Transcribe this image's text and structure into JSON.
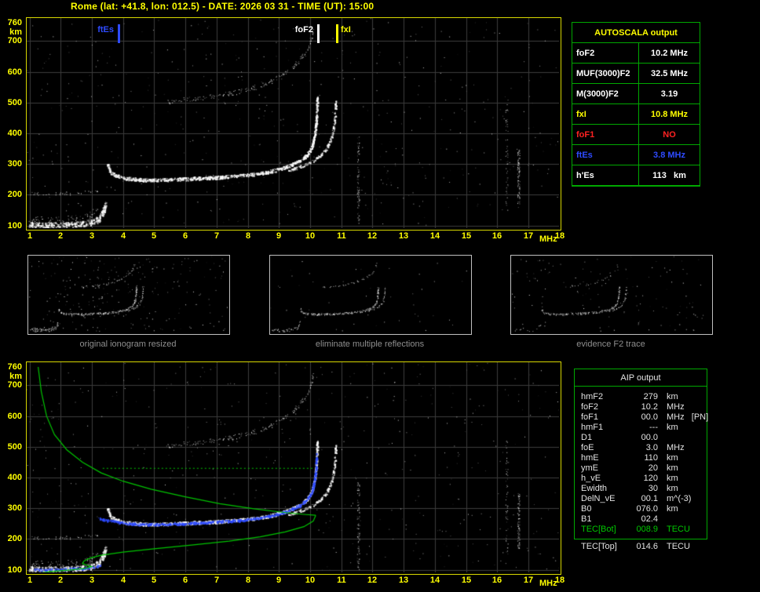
{
  "title": "Rome (lat: +41.8, lon: 012.5) - DATE: 2026 03 31 - TIME (UT): 15:00",
  "colors": {
    "accent_yellow": "#ffff00",
    "grid": "#3c3c3c",
    "border_green": "#00a800",
    "trace_white": "#ffffff",
    "fit_blue": "#2e4bff",
    "profile_green": "#00c400",
    "alert_red": "#ff2222",
    "caption_gray": "#8f8f8f"
  },
  "autoscala": {
    "header": "AUTOSCALA output",
    "rows": [
      {
        "label": "foF2",
        "value": "10.2 MHz",
        "color": "#ffffff"
      },
      {
        "label": "MUF(3000)F2",
        "value": "32.5 MHz",
        "color": "#ffffff"
      },
      {
        "label": "M(3000)F2",
        "value": "3.19",
        "color": "#ffffff"
      },
      {
        "label": "fxI",
        "value": "10.8 MHz",
        "color": "#ffff00"
      },
      {
        "label": "foF1",
        "value": "NO",
        "color": "#ff2222"
      },
      {
        "label": "ftEs",
        "value": "3.8 MHz",
        "color": "#2e4bff"
      },
      {
        "label": "h'Es",
        "value": "113   km",
        "color": "#ffffff"
      }
    ]
  },
  "aip": {
    "header": "AIP output",
    "rows": [
      {
        "label": "hmF2",
        "value": "279",
        "unit": "km"
      },
      {
        "label": "foF2",
        "value": "10.2",
        "unit": "MHz"
      },
      {
        "label": "foF1",
        "value": "00.0",
        "unit": "MHz   [PN]"
      },
      {
        "label": "hmF1",
        "value": "---",
        "unit": "km"
      },
      {
        "label": "D1",
        "value": "00.0",
        "unit": ""
      },
      {
        "label": "foE",
        "value": "3.0",
        "unit": "MHz"
      },
      {
        "label": "hmE",
        "value": "110",
        "unit": "km"
      },
      {
        "label": "ymE",
        "value": "20",
        "unit": "km"
      },
      {
        "label": "h_vE",
        "value": "120",
        "unit": "km"
      },
      {
        "label": "Ewidth",
        "value": "30",
        "unit": "km"
      },
      {
        "label": "DelN_vE",
        "value": "00.1",
        "unit": "m^(-3)"
      },
      {
        "label": "B0",
        "value": "076.0",
        "unit": "km"
      },
      {
        "label": "B1",
        "value": "02.4",
        "unit": ""
      },
      {
        "label": "TEC[Bot]",
        "value": "008.9",
        "unit": "TECU",
        "color": "green"
      }
    ],
    "footer_row": {
      "label": "TEC[Top]",
      "value": "014.6",
      "unit": "TECU"
    }
  },
  "thumbnails": [
    {
      "caption": "original ionogram resized"
    },
    {
      "caption": "eliminate multiple reflections"
    },
    {
      "caption": "evidence F2 trace"
    }
  ],
  "axes": {
    "x_ticks": [
      1,
      2,
      3,
      4,
      5,
      6,
      7,
      8,
      9,
      10,
      11,
      12,
      13,
      14,
      15,
      16,
      17,
      18
    ],
    "x_unit": "MHz",
    "y_ticks": [
      760,
      700,
      600,
      500,
      400,
      300,
      200,
      100
    ],
    "y_unit": "km"
  },
  "markers": [
    {
      "label": "ftEs",
      "freq": 3.8,
      "color": "#2e4bff",
      "side": "left"
    },
    {
      "label": "foF2",
      "freq": 10.2,
      "color": "#ffffff",
      "side": "left"
    },
    {
      "label": "fxI",
      "freq": 10.8,
      "color": "#ffff00",
      "side": "right"
    }
  ],
  "chart_data": {
    "type": "scatter",
    "x_range": [
      1,
      18
    ],
    "y_range": [
      100,
      760
    ],
    "xlabel": "MHz",
    "ylabel": "km",
    "grid": true,
    "traces": {
      "E": [
        [
          1.0,
          104
        ],
        [
          1.5,
          101
        ],
        [
          2.1,
          102
        ],
        [
          2.6,
          105
        ],
        [
          2.95,
          110
        ],
        [
          3.15,
          118
        ],
        [
          3.3,
          132
        ],
        [
          3.38,
          152
        ],
        [
          3.42,
          172
        ]
      ],
      "Es_spread": [
        [
          1.05,
          118
        ],
        [
          1.6,
          114
        ],
        [
          2.2,
          117
        ],
        [
          2.7,
          124
        ],
        [
          3.0,
          134
        ],
        [
          3.15,
          146
        ]
      ],
      "E_second_order": [
        [
          1.0,
          206
        ],
        [
          1.9,
          203
        ],
        [
          2.7,
          208
        ],
        [
          3.15,
          216
        ]
      ],
      "F_ordinary": [
        [
          3.5,
          298
        ],
        [
          3.58,
          276
        ],
        [
          3.75,
          263
        ],
        [
          4.1,
          254
        ],
        [
          4.7,
          249
        ],
        [
          5.5,
          250
        ],
        [
          6.3,
          254
        ],
        [
          7.1,
          258
        ],
        [
          7.8,
          263
        ],
        [
          8.4,
          271
        ],
        [
          8.9,
          281
        ],
        [
          9.3,
          294
        ],
        [
          9.65,
          310
        ],
        [
          9.9,
          330
        ],
        [
          10.05,
          356
        ],
        [
          10.13,
          390
        ],
        [
          10.18,
          430
        ],
        [
          10.21,
          478
        ],
        [
          10.22,
          520
        ]
      ],
      "F_extraordinary": [
        [
          9.3,
          280
        ],
        [
          9.7,
          293
        ],
        [
          10.0,
          307
        ],
        [
          10.3,
          325
        ],
        [
          10.5,
          348
        ],
        [
          10.65,
          378
        ],
        [
          10.74,
          415
        ],
        [
          10.79,
          458
        ],
        [
          10.82,
          505
        ]
      ],
      "F_second_order": [
        [
          5.4,
          505
        ],
        [
          6.1,
          512
        ],
        [
          6.9,
          521
        ],
        [
          7.6,
          533
        ],
        [
          8.2,
          549
        ],
        [
          8.7,
          568
        ],
        [
          9.1,
          590
        ],
        [
          9.45,
          615
        ],
        [
          9.7,
          642
        ],
        [
          9.9,
          672
        ],
        [
          10.03,
          704
        ],
        [
          10.1,
          736
        ]
      ]
    },
    "noise_streaks": [
      {
        "f": 11.54,
        "km": [
          100,
          390
        ],
        "n": 85
      },
      {
        "f": 16.3,
        "km": [
          150,
          520
        ],
        "n": 55
      },
      {
        "f": 16.68,
        "km": [
          170,
          350
        ],
        "n": 95
      }
    ],
    "fit_blue": {
      "E": [
        [
          1.15,
          100
        ],
        [
          1.9,
          102
        ],
        [
          2.6,
          105
        ],
        [
          3.1,
          110
        ],
        [
          3.3,
          116
        ]
      ],
      "F": [
        [
          3.2,
          268
        ],
        [
          3.6,
          259
        ],
        [
          4.1,
          252
        ],
        [
          4.7,
          248
        ],
        [
          5.5,
          249
        ],
        [
          6.3,
          253
        ],
        [
          7.1,
          257
        ],
        [
          7.8,
          262
        ],
        [
          8.4,
          270
        ],
        [
          8.9,
          280
        ],
        [
          9.3,
          293
        ],
        [
          9.65,
          309
        ],
        [
          9.9,
          329
        ],
        [
          10.05,
          355
        ],
        [
          10.13,
          390
        ],
        [
          10.18,
          432
        ],
        [
          10.2,
          480
        ]
      ]
    },
    "profile_green": {
      "topside": [
        [
          1.28,
          760
        ],
        [
          1.38,
          680
        ],
        [
          1.55,
          600
        ],
        [
          1.8,
          540
        ],
        [
          2.2,
          490
        ],
        [
          2.7,
          450
        ],
        [
          3.3,
          415
        ],
        [
          4.0,
          388
        ],
        [
          4.9,
          362
        ],
        [
          6.0,
          337
        ],
        [
          7.1,
          315
        ],
        [
          8.2,
          298
        ],
        [
          9.1,
          287
        ],
        [
          9.8,
          280
        ],
        [
          10.18,
          277
        ]
      ],
      "bottomside": [
        [
          10.18,
          277
        ],
        [
          10.1,
          258
        ],
        [
          9.8,
          240
        ],
        [
          9.2,
          223
        ],
        [
          8.4,
          207
        ],
        [
          7.4,
          193
        ],
        [
          6.2,
          180
        ],
        [
          5.0,
          168
        ],
        [
          4.0,
          157
        ],
        [
          3.3,
          147
        ],
        [
          2.95,
          138
        ],
        [
          2.75,
          128
        ],
        [
          2.7,
          120
        ],
        [
          2.85,
          114
        ],
        [
          3.0,
          110
        ],
        [
          2.8,
          104
        ],
        [
          2.3,
          99
        ],
        [
          1.7,
          94
        ],
        [
          1.25,
          88
        ],
        [
          1.0,
          80
        ]
      ],
      "dotted_km": 430,
      "dotted_f": [
        3.35,
        10.15
      ]
    }
  }
}
